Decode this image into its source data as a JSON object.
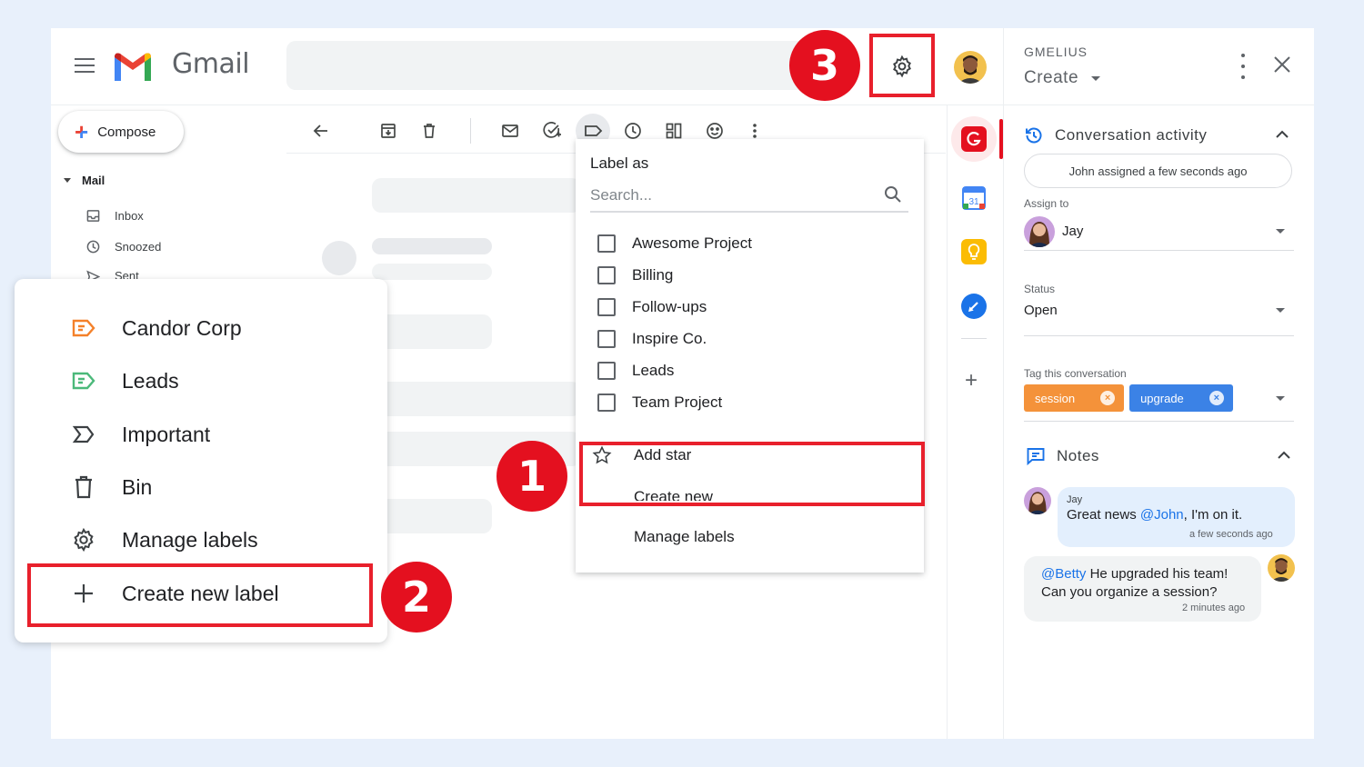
{
  "app": {
    "name": "Gmail"
  },
  "nav": {
    "compose": "Compose",
    "mail_heading": "Mail",
    "items": [
      {
        "label": "Inbox",
        "icon": "inbox-icon"
      },
      {
        "label": "Snoozed",
        "icon": "clock-icon"
      },
      {
        "label": "Sent",
        "icon": "send-icon"
      }
    ]
  },
  "label_panel": {
    "items": [
      {
        "label": "Candor Corp",
        "icon": "label-icon",
        "color": "#f4812a"
      },
      {
        "label": "Leads",
        "icon": "label-icon",
        "color": "#4bb97a"
      },
      {
        "label": "Important",
        "icon": "important-icon"
      },
      {
        "label": "Bin",
        "icon": "trash-icon"
      },
      {
        "label": "Manage labels",
        "icon": "gear-icon"
      },
      {
        "label": "Create new label",
        "icon": "plus-icon"
      }
    ]
  },
  "label_menu": {
    "title": "Label as",
    "search_placeholder": "Search...",
    "labels": [
      "Awesome Project",
      "Billing",
      "Follow-ups",
      "Inspire Co.",
      "Leads",
      "Team Project"
    ],
    "add_star": "Add star",
    "create_new": "Create new",
    "manage_labels": "Manage labels"
  },
  "badges": {
    "one": "1",
    "two": "2",
    "three": "3"
  },
  "side_panel": {
    "brand": "GMELIUS",
    "create": "Create",
    "activity_title": "Conversation activity",
    "activity_text": "John assigned a few seconds ago",
    "assign_label": "Assign to",
    "assignee": "Jay",
    "status_label": "Status",
    "status_value": "Open",
    "tag_label": "Tag this conversation",
    "tags": [
      {
        "label": "session",
        "color": "#f4923a"
      },
      {
        "label": "upgrade",
        "color": "#3b82e6"
      }
    ],
    "notes_title": "Notes",
    "notes": [
      {
        "author": "Jay",
        "prefix": "Great news ",
        "mention": "@John",
        "suffix": ", I'm on it.",
        "time": "a few seconds ago"
      },
      {
        "mention": "@Betty",
        "line1": " He upgraded his team!",
        "line2": "Can you organize a session?",
        "time": "2 minutes ago"
      }
    ]
  },
  "colors": {
    "highlight": "#e8202c",
    "badge": "#e4101f",
    "accent": "#1a73e8"
  }
}
